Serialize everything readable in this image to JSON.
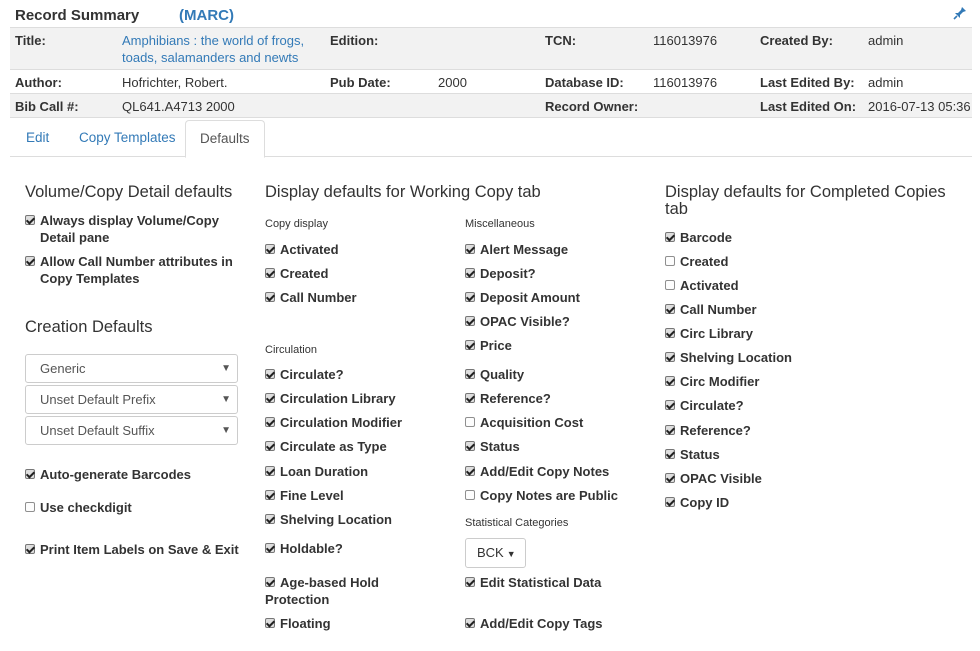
{
  "summary": {
    "title": "Record Summary",
    "marc_link": "(MARC)",
    "pin_icon": "pin-icon",
    "rows": {
      "title_label": "Title:",
      "title_value_line1": "Amphibians : the world of frogs,",
      "title_value_line2": "toads, salamanders and newts",
      "edition_label": "Edition:",
      "edition_value": "",
      "tcn_label": "TCN:",
      "tcn_value": "116013976",
      "created_by_label": "Created By:",
      "created_by_value": "admin",
      "author_label": "Author:",
      "author_value": "Hofrichter, Robert.",
      "pub_date_label": "Pub Date:",
      "pub_date_value": "2000",
      "database_id_label": "Database ID:",
      "database_id_value": "116013976",
      "last_edited_by_label": "Last Edited By:",
      "last_edited_by_value": "admin",
      "bib_call_label": "Bib Call #:",
      "bib_call_value": "QL641.A4713 2000",
      "record_owner_label": "Record Owner:",
      "record_owner_value": "",
      "last_edited_on_label": "Last Edited On:",
      "last_edited_on_value": "2016-07-13 05:36"
    }
  },
  "tabs": [
    "Edit",
    "Copy Templates",
    "Defaults"
  ],
  "active_tab": "Defaults",
  "col1": {
    "heading": "Volume/Copy Detail defaults",
    "always_display": "Always display Volume/Copy Detail pane",
    "allow_call_number": "Allow Call Number attributes in Copy Templates",
    "creation_heading": "Creation Defaults",
    "select_generic": "Generic",
    "select_prefix": "Unset Default Prefix",
    "select_suffix": "Unset Default Suffix",
    "auto_generate": "Auto-generate Barcodes",
    "use_checkdigit": "Use checkdigit",
    "print_labels": "Print Item Labels on Save & Exit"
  },
  "col2": {
    "heading": "Display defaults for Working Copy tab",
    "copy_display_heading": "Copy display",
    "activated": "Activated",
    "created": "Created",
    "call_number": "Call Number",
    "circulation_heading": "Circulation",
    "circulate": "Circulate?",
    "circulation_library": "Circulation Library",
    "circulation_modifier": "Circulation Modifier",
    "circulate_as_type": "Circulate as Type",
    "loan_duration": "Loan Duration",
    "fine_level": "Fine Level",
    "shelving_location": "Shelving Location",
    "holdable": "Holdable?",
    "age_hold": "Age-based Hold Protection",
    "floating": "Floating"
  },
  "col3": {
    "misc_heading": "Miscellaneous",
    "alert_message": "Alert Message",
    "deposit": "Deposit?",
    "deposit_amount": "Deposit Amount",
    "opac_visible": "OPAC Visible?",
    "price": "Price",
    "quality": "Quality",
    "reference": "Reference?",
    "acquisition_cost": "Acquisition Cost",
    "status": "Status",
    "add_edit_notes": "Add/Edit Copy Notes",
    "notes_public": "Copy Notes are Public",
    "stat_heading": "Statistical Categories",
    "bck_button": "BCK",
    "edit_stat_data": "Edit Statistical Data",
    "add_edit_tags": "Add/Edit Copy Tags"
  },
  "col4": {
    "heading_line1": "Display defaults for Completed Copies",
    "heading_line2": "tab",
    "barcode": "Barcode",
    "created": "Created",
    "activated": "Activated",
    "call_number": "Call Number",
    "circ_library": "Circ Library",
    "shelving_location": "Shelving Location",
    "circ_modifier": "Circ Modifier",
    "circulate": "Circulate?",
    "reference": "Reference?",
    "status": "Status",
    "opac_visible": "OPAC Visible",
    "copy_id": "Copy ID"
  }
}
